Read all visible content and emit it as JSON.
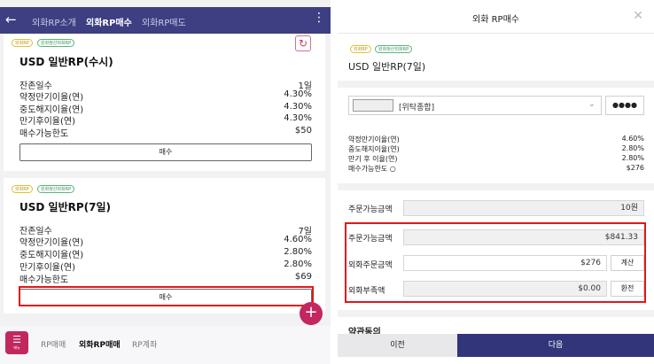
{
  "left": {
    "header": {
      "back_icon": "arrow-left-icon",
      "tabs": [
        {
          "label": "외화RP소개",
          "active": false
        },
        {
          "label": "외화RP매수",
          "active": true
        },
        {
          "label": "외화RP매도",
          "active": false
        }
      ],
      "more_icon": "kebab-icon"
    },
    "cards": [
      {
        "badges": [
          "외화RP",
          "원화정산외화RP"
        ],
        "title": "USD 일반RP(수시)",
        "rows": [
          {
            "label": "잔존일수",
            "value": "1일"
          },
          {
            "label": "약정만기이율(연)",
            "value": "4.30%"
          },
          {
            "label": "중도해지이율(연)",
            "value": "4.30%"
          },
          {
            "label": "만기후이율(연)",
            "value": "4.30%"
          },
          {
            "label": "매수가능한도",
            "value": "$50"
          }
        ],
        "buy_label": "매수"
      },
      {
        "badges": [
          "외화RP",
          "원화정산외화RP"
        ],
        "title": "USD 일반RP(7일)",
        "rows": [
          {
            "label": "잔존일수",
            "value": "7일"
          },
          {
            "label": "약정만기이율(연)",
            "value": "4.60%"
          },
          {
            "label": "중도해지이율(연)",
            "value": "2.80%"
          },
          {
            "label": "만기후이율(연)",
            "value": "2.80%"
          },
          {
            "label": "매수가능한도",
            "value": "$69"
          }
        ],
        "buy_label": "매수"
      }
    ],
    "refresh_icon": "refresh-icon",
    "fab_icon": "plus-icon",
    "bottom_nav": {
      "menu_label": "메뉴",
      "items": [
        {
          "label": "RP매매",
          "active": false
        },
        {
          "label": "외화RP매매",
          "active": true
        },
        {
          "label": "RP계좌",
          "active": false
        }
      ]
    }
  },
  "right": {
    "title": "외화 RP매수",
    "close_icon": "close-icon",
    "badges": [
      "외화RP",
      "원화정산외화RP"
    ],
    "product_title": "USD 일반RP(7일)",
    "account": {
      "type": "[위탁종합]",
      "password_mask": "●●●●"
    },
    "summary": [
      {
        "label": "약정만기이율(연)",
        "value": "4.60%"
      },
      {
        "label": "중도해지이율(연)",
        "value": "2.80%"
      },
      {
        "label": "만기 후 이율(연)",
        "value": "2.80%"
      },
      {
        "label": "매수가능한도 ○",
        "value": "$276"
      }
    ],
    "order_krw": {
      "label": "주문가능금액",
      "value": "10원"
    },
    "order_usd": {
      "label": "주문가능금액",
      "value": "$841.33"
    },
    "fx_order": {
      "label": "외화주문금액",
      "value": "$276",
      "button": "계산"
    },
    "fx_short": {
      "label": "외화부족액",
      "value": "$0.00",
      "button": "환전"
    },
    "terms_label": "약관동의",
    "prev_label": "이전",
    "next_label": "다음"
  },
  "colors": {
    "header": "#3d3f82",
    "accent": "#c2275f",
    "highlight": "#e01818",
    "next": "#33357a"
  }
}
